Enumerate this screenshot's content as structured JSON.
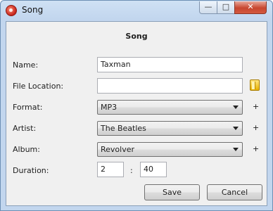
{
  "window": {
    "title": "Song",
    "controls": {
      "minimize": "—",
      "maximize": "□",
      "close": "✕"
    }
  },
  "form": {
    "heading": "Song",
    "name": {
      "label": "Name:",
      "value": "Taxman"
    },
    "file_location": {
      "label": "File Location:",
      "value": "",
      "icon": "folder-icon"
    },
    "format": {
      "label": "Format:",
      "value": "MP3",
      "add": "+"
    },
    "artist": {
      "label": "Artist:",
      "value": "The Beatles",
      "add": "+"
    },
    "album": {
      "label": "Album:",
      "value": "Revolver",
      "add": "+"
    },
    "duration": {
      "label": "Duration:",
      "minutes": "2",
      "separator": ":",
      "seconds": "40"
    }
  },
  "buttons": {
    "save": "Save",
    "cancel": "Cancel"
  }
}
